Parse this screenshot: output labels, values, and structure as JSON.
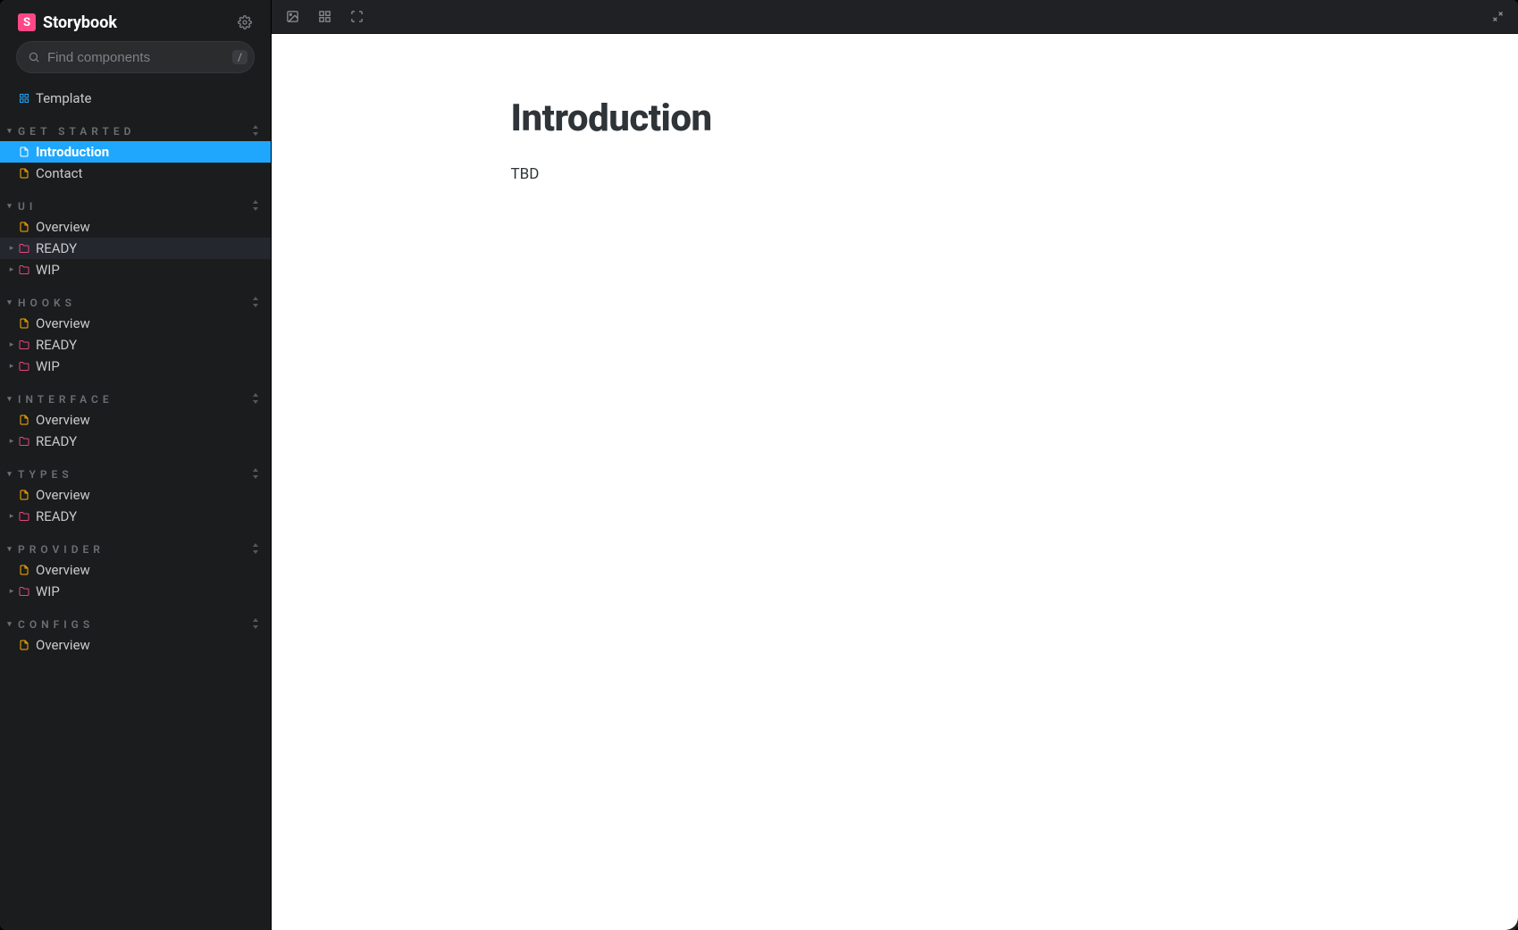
{
  "brand": {
    "badge": "S",
    "name": "Storybook"
  },
  "search": {
    "placeholder": "Find components",
    "shortcut": "/"
  },
  "topItem": {
    "label": "Template",
    "icon": "component"
  },
  "groups": [
    {
      "key": "get_started",
      "label": "GET STARTED",
      "items": [
        {
          "label": "Introduction",
          "icon": "doc",
          "selected": true
        },
        {
          "label": "Contact",
          "icon": "doc"
        }
      ]
    },
    {
      "key": "ui",
      "label": "UI",
      "items": [
        {
          "label": "Overview",
          "icon": "doc"
        },
        {
          "label": "READY",
          "icon": "folder",
          "expandable": true,
          "hovered": true
        },
        {
          "label": "WIP",
          "icon": "folder",
          "expandable": true
        }
      ]
    },
    {
      "key": "hooks",
      "label": "HOOKS",
      "items": [
        {
          "label": "Overview",
          "icon": "doc"
        },
        {
          "label": "READY",
          "icon": "folder",
          "expandable": true
        },
        {
          "label": "WIP",
          "icon": "folder",
          "expandable": true
        }
      ]
    },
    {
      "key": "interface",
      "label": "INTERFACE",
      "items": [
        {
          "label": "Overview",
          "icon": "doc"
        },
        {
          "label": "READY",
          "icon": "folder",
          "expandable": true
        }
      ]
    },
    {
      "key": "types",
      "label": "TYPES",
      "items": [
        {
          "label": "Overview",
          "icon": "doc"
        },
        {
          "label": "READY",
          "icon": "folder",
          "expandable": true
        }
      ]
    },
    {
      "key": "provider",
      "label": "PROVIDER",
      "items": [
        {
          "label": "Overview",
          "icon": "doc"
        },
        {
          "label": "WIP",
          "icon": "folder",
          "expandable": true
        }
      ]
    },
    {
      "key": "configs",
      "label": "CONFIGS",
      "items": [
        {
          "label": "Overview",
          "icon": "doc"
        }
      ]
    }
  ],
  "doc": {
    "title": "Introduction",
    "body": "TBD"
  },
  "iconColors": {
    "component": "#1ea7fd",
    "doc": "#ffae00",
    "doc_selected": "#ffffff",
    "folder": "#e6467f"
  }
}
